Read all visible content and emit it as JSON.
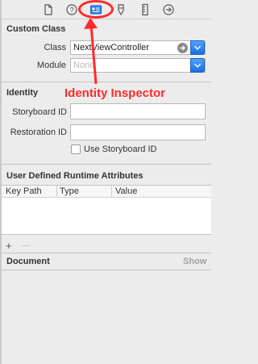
{
  "toolbar": {
    "icons": [
      "file-inspector-icon",
      "quick-help-icon",
      "identity-inspector-icon",
      "attributes-inspector-icon",
      "size-inspector-icon",
      "connections-inspector-icon"
    ],
    "highlight_color": "#ff2a2a"
  },
  "custom_class": {
    "title": "Custom Class",
    "class_label": "Class",
    "class_value": "NextViewController",
    "module_label": "Module",
    "module_placeholder": "None"
  },
  "annotation": {
    "text": "Identity Inspector",
    "color": "#ff2a2a"
  },
  "identity": {
    "title": "Identity",
    "storyboard_id_label": "Storyboard ID",
    "storyboard_id_value": "",
    "restoration_id_label": "Restoration ID",
    "restoration_id_value": "",
    "use_storyboard_id_label": "Use Storyboard ID",
    "use_storyboard_id_checked": false
  },
  "runtime_attributes": {
    "title": "User Defined Runtime Attributes",
    "columns": [
      "Key Path",
      "Type",
      "Value"
    ],
    "rows": [],
    "add_label": "+",
    "remove_label": "—"
  },
  "document": {
    "title": "Document",
    "show_label": "Show"
  }
}
